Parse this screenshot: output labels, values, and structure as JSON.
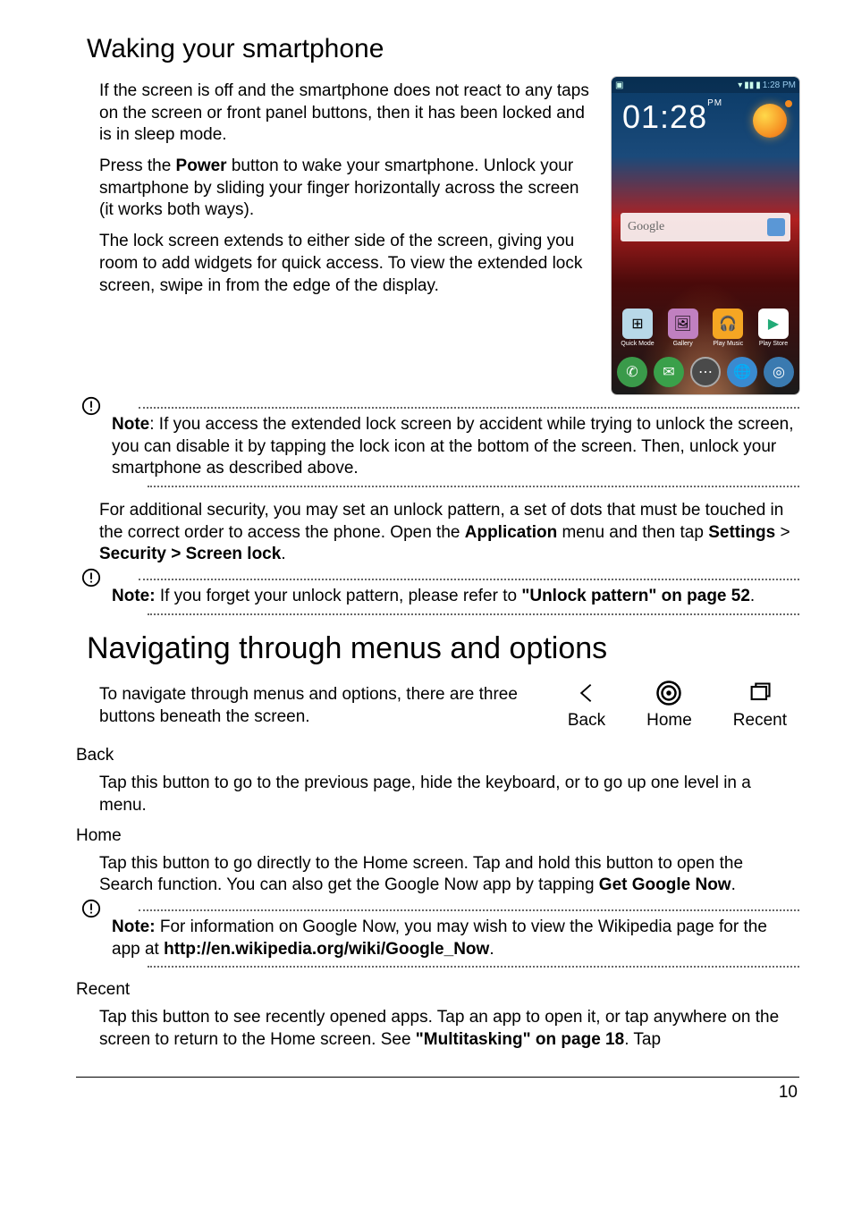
{
  "headings": {
    "waking": "Waking your smartphone",
    "navigating": "Navigating through menus and options",
    "back": "Back",
    "home": "Home",
    "recent": "Recent"
  },
  "waking": {
    "p1": "If the screen is off and the smartphone does not react to any taps on the screen or front panel buttons, then it has been locked and is in sleep mode.",
    "p2a": "Press the ",
    "p2_power": "Power",
    "p2b": " button to wake your smartphone. Unlock your smartphone by sliding your finger horizontally across the screen (it works both ways).",
    "p3": "The lock screen extends to either side of the screen, giving you room to add widgets for quick access. To view the extended lock screen, swipe in from the edge of the display."
  },
  "note1": {
    "label": "Note",
    "rest": ": If you access the extended lock screen by accident while trying to unlock the screen, you can disable it by tapping the lock icon at the bottom of the screen. Then, unlock your smartphone as described above."
  },
  "security": {
    "a": "For additional security, you may set an unlock pattern, a set of dots that must be touched in the correct order to access the phone. Open the ",
    "app": "Application",
    "b": " menu and then tap ",
    "settings": "Settings",
    "gt": " > ",
    "sec": "Security > Screen lock",
    "dot": "."
  },
  "note2": {
    "label": "Note:",
    "pre": " If you forget your unlock pattern, please refer to ",
    "link": "\"Unlock pattern\" on page 52",
    "dot": "."
  },
  "nav": {
    "intro": "To navigate through menus and options, there are three buttons beneath the screen.",
    "labels": {
      "back": "Back",
      "home": "Home",
      "recent": "Recent"
    }
  },
  "back_text": "Tap this button to go to the previous page, hide the keyboard, or to go up one level in a menu.",
  "home_text": {
    "a": "Tap this button to go directly to the Home screen. Tap and hold this button to open the Search function. You can also get the Google Now app by tapping ",
    "get": "Get Google Now",
    "dot": "."
  },
  "note3": {
    "label": "Note:",
    "pre": " For information on Google Now, you may wish to view the Wikipedia page for the app at ",
    "url": "http://en.wikipedia.org/wiki/Google_Now",
    "dot": "."
  },
  "recent_text": {
    "a": "Tap this button to see recently opened apps. Tap an app to open it, or tap anywhere on the screen to return to the Home screen. See ",
    "link": "\"Multitasking\" on page 18",
    "b": ". Tap"
  },
  "page_number": "10",
  "phone": {
    "status_time": "1:28 PM",
    "clock": "01:28",
    "clock_suffix": "PM",
    "google": "Google",
    "apps": {
      "quick": "Quick Mode",
      "gallery": "Gallery",
      "music": "Play Music",
      "store": "Play Store"
    }
  }
}
